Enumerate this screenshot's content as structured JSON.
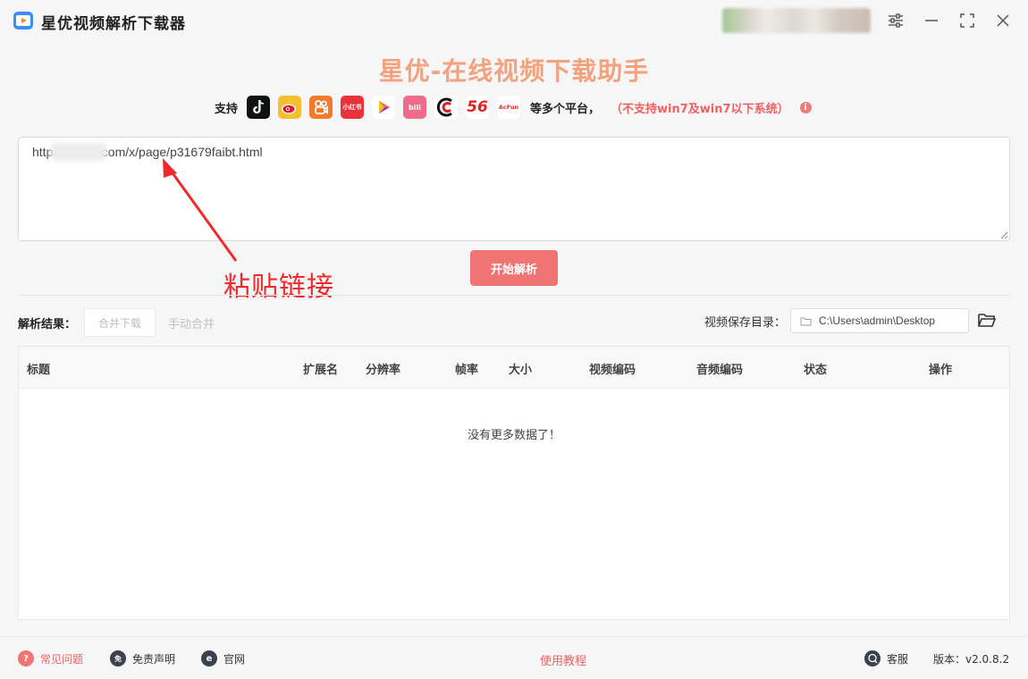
{
  "window": {
    "title": "星优视频解析下载器",
    "controls": [
      "settings-icon",
      "minimize-icon",
      "maximize-icon",
      "close-icon"
    ]
  },
  "header": {
    "headline": "星优-在线视频下载助手",
    "support_label": "支持",
    "platforms": [
      {
        "name": "tiktok",
        "glyph": "♪",
        "color": "#111111"
      },
      {
        "name": "weibo",
        "glyph": "◉",
        "color": "#f4c032"
      },
      {
        "name": "kuaishou",
        "glyph": "▣",
        "color": "#f07b2e"
      },
      {
        "name": "xiaohongshu",
        "glyph": "小红书",
        "color": "#e8333d"
      },
      {
        "name": "iqiyi-play",
        "glyph": "▶",
        "color": "#ffffff"
      },
      {
        "name": "bilibili",
        "glyph": "bili",
        "color": "#ef6b8b"
      },
      {
        "name": "cctv",
        "glyph": "C",
        "color": "#ffffff"
      },
      {
        "name": "56",
        "glyph": "56",
        "color": "#ffffff"
      },
      {
        "name": "acfun",
        "glyph": "AcFun",
        "color": "#ffffff"
      }
    ],
    "many_label": "等多个平台，",
    "warning": "（不支持win7及win7以下系统）",
    "info_glyph": "i"
  },
  "url_input": {
    "value": "http://          .com/x/page/p31679faibt.html"
  },
  "parse_button": "开始解析",
  "annotation": {
    "text": "粘贴链接",
    "color": "#ee2a2a"
  },
  "toolbar": {
    "result_label": "解析结果：",
    "merge_download": "合并下载",
    "manual_merge": "手动合并",
    "save_dir_label": "视频保存目录：",
    "save_dir_value": "C:\\Users\\admin\\Desktop"
  },
  "table": {
    "columns": [
      "标题",
      "扩展名",
      "分辨率",
      "帧率",
      "大小",
      "视频编码",
      "音频编码",
      "状态",
      "操作"
    ],
    "empty_message": "没有更多数据了！"
  },
  "footer": {
    "faq": "常见问题",
    "disclaimer": "免责声明",
    "website": "官网",
    "tutorial": "使用教程",
    "support": "客服",
    "version": "版本：v2.0.8.2"
  },
  "colors": {
    "accent": "#f07474",
    "headline": "#f3a27f",
    "warning": "#f06060"
  }
}
